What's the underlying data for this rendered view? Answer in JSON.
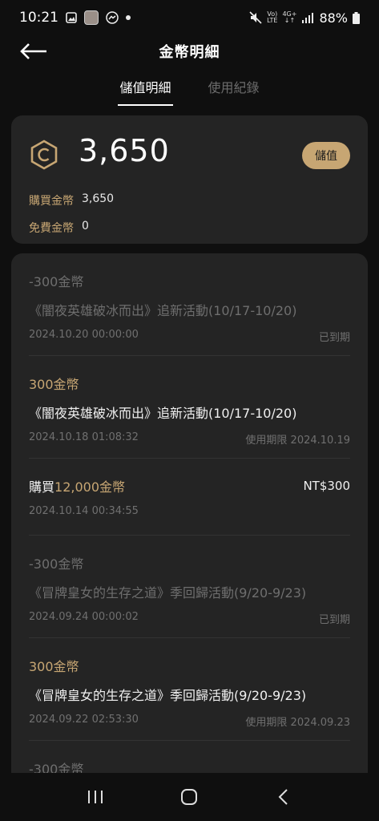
{
  "status": {
    "time": "10:21",
    "network_top": "Vo)",
    "network_bottom": "LTE",
    "network2_top": "4G+",
    "network2_bottom": "↓↑",
    "battery": "88%"
  },
  "header": {
    "title": "金幣明細"
  },
  "tabs": [
    {
      "label": "儲值明細",
      "active": true
    },
    {
      "label": "使用紀錄",
      "active": false
    }
  ],
  "balance": {
    "amount": "3,650",
    "topup_label": "儲值",
    "purchased_label": "購買金幣",
    "purchased_value": "3,650",
    "free_label": "免費金幣",
    "free_value": "0"
  },
  "records": [
    {
      "title": "-300金幣",
      "desc": "《闇夜英雄破冰而出》追新活動(10/17-10/20)",
      "date": "2024.10.20 00:00:00",
      "note": "已到期"
    },
    {
      "title": "300金幣",
      "desc": "《闇夜英雄破冰而出》追新活動(10/17-10/20)",
      "date": "2024.10.18 01:08:32",
      "note": "使用期限 2024.10.19"
    },
    {
      "title_prefix": "購買",
      "title_amount": "12,000金幣",
      "price": "NT$300",
      "date": "2024.10.14 00:34:55"
    },
    {
      "title": "-300金幣",
      "desc": "《冒牌皇女的生存之道》季回歸活動(9/20-9/23)",
      "date": "2024.09.24 00:00:02",
      "note": "已到期"
    },
    {
      "title": "300金幣",
      "desc": "《冒牌皇女的生存之道》季回歸活動(9/20-9/23)",
      "date": "2024.09.22 02:53:30",
      "note": "使用期限 2024.09.23"
    },
    {
      "title": "-300金幣"
    }
  ],
  "colors": {
    "accent_gold": "#c7a673",
    "background": "#0f0f0f",
    "card": "#242424"
  },
  "icons": {
    "back": "arrow-left-icon",
    "coin": "coin-icon",
    "nav_recent": "recent-apps-icon",
    "nav_home": "home-icon",
    "nav_back": "chevron-left-icon"
  }
}
